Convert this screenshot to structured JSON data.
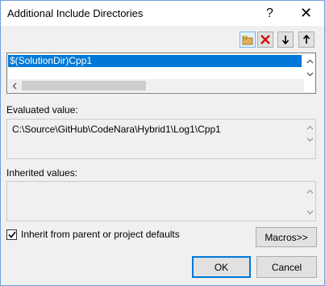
{
  "window": {
    "title": "Additional Include Directories",
    "help_label": "?",
    "close_label": "✕"
  },
  "toolbar": {
    "new_line_icon": "new-folder-icon",
    "delete_icon": "delete-x-icon",
    "move_down_icon": "arrow-down-icon",
    "move_up_icon": "arrow-up-icon"
  },
  "list": {
    "items": [
      "$(SolutionDir)Cpp1"
    ]
  },
  "evaluated": {
    "label": "Evaluated value:",
    "value": "C:\\Source\\GitHub\\CodeNara\\Hybrid1\\Log1\\Cpp1"
  },
  "inherited": {
    "label": "Inherited values:",
    "value": ""
  },
  "inherit_checkbox": {
    "label": "Inherit from parent or project defaults",
    "checked": true
  },
  "buttons": {
    "macros": "Macros>>",
    "ok": "OK",
    "cancel": "Cancel"
  },
  "colors": {
    "selection": "#0078d7",
    "accent_border": "#0078d7",
    "delete_red": "#d01010"
  }
}
